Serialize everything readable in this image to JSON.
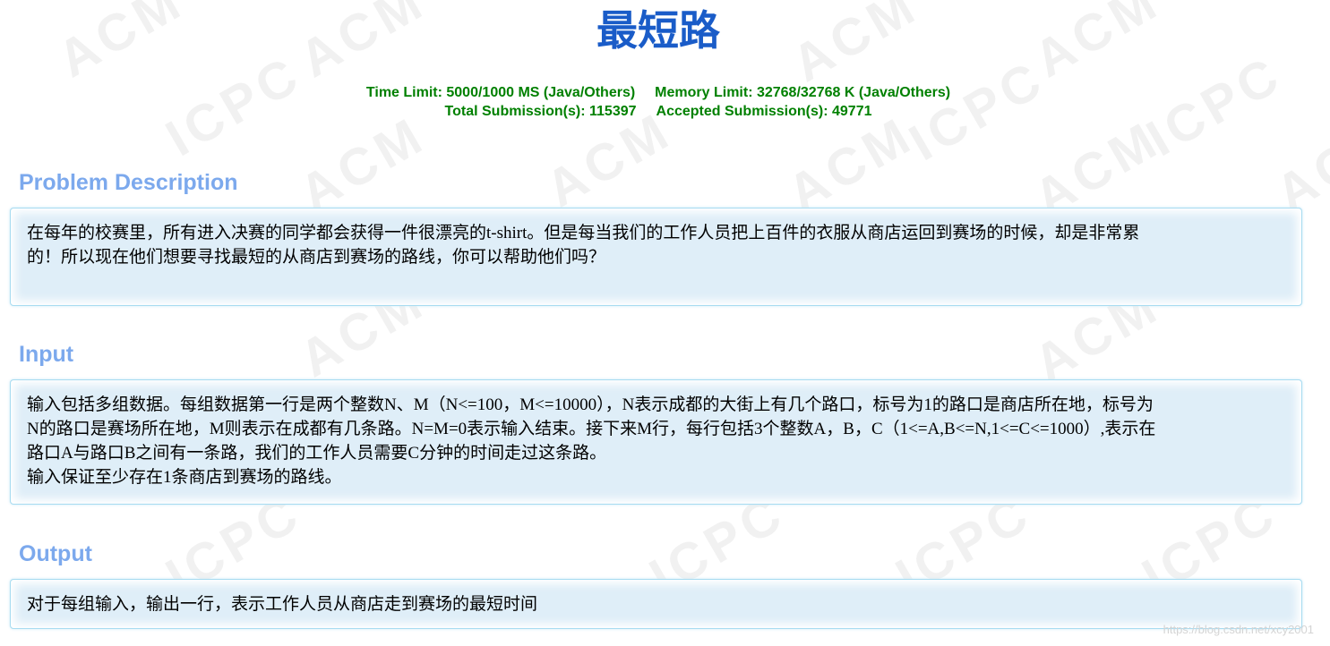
{
  "problem": {
    "title": "最短路",
    "limits": {
      "time_limit": "Time Limit: 5000/1000 MS (Java/Others)",
      "memory_limit": "Memory Limit: 32768/32768 K (Java/Others)",
      "total_submissions": "Total Submission(s): 115397",
      "accepted_submissions": "Accepted Submission(s): 49771"
    },
    "sections": {
      "description": {
        "heading": "Problem Description",
        "lines": [
          "在每年的校赛里，所有进入决赛的同学都会获得一件很漂亮的t-shirt。但是每当我们的工作人员把上百件的衣服从商店运回到赛场的时候，却是非常累",
          "的！所以现在他们想要寻找最短的从商店到赛场的路线，你可以帮助他们吗？"
        ]
      },
      "input": {
        "heading": "Input",
        "lines": [
          "输入包括多组数据。每组数据第一行是两个整数N、M（N<=100，M<=10000），N表示成都的大街上有几个路口，标号为1的路口是商店所在地，标号为",
          "N的路口是赛场所在地，M则表示在成都有几条路。N=M=0表示输入结束。接下来M行，每行包括3个整数A，B，C（1<=A,B<=N,1<=C<=1000）,表示在",
          "路口A与路口B之间有一条路，我们的工作人员需要C分钟的时间走过这条路。",
          "输入保证至少存在1条商店到赛场的路线。"
        ]
      },
      "output": {
        "heading": "Output",
        "lines": [
          "对于每组输入，输出一行，表示工作人员从商店走到赛场的最短时间"
        ]
      }
    }
  },
  "watermark": {
    "texts": [
      "ACM",
      "ICPC"
    ]
  },
  "credit": "https://blog.csdn.net/xcy2001",
  "colors": {
    "title": "#1a5cc8",
    "limits": "#008000",
    "section_heading": "#7ca9ed",
    "panel_background": "#dfeef8",
    "panel_border": "#a8dcf1"
  }
}
